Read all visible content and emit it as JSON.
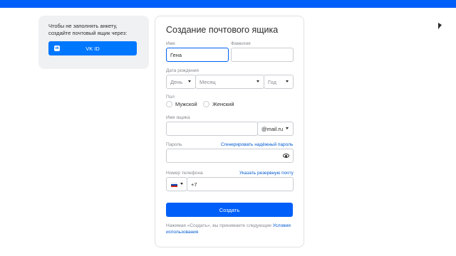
{
  "vk": {
    "hint": "Чтобы не заполнять анкету, создайте почтовый ящик через:",
    "button_label": "VK ID"
  },
  "form": {
    "title": "Создание почтового ящика",
    "first_name": {
      "label": "Имя",
      "value": "Гена"
    },
    "last_name": {
      "label": "Фамилия",
      "value": ""
    },
    "birth_date": {
      "label": "Дата рождения",
      "day": "День",
      "month": "Месяц",
      "year": "Год"
    },
    "gender": {
      "label": "Пол",
      "male": "Мужской",
      "female": "Женский"
    },
    "mailbox": {
      "label": "Имя ящика",
      "value": "",
      "domain": "@mail.ru"
    },
    "password": {
      "label": "Пароль",
      "generate_link": "Сгенерировать надёжный пароль",
      "value": ""
    },
    "phone": {
      "label": "Номер телефона",
      "backup_link": "Указать резервную почту",
      "prefix": "+7"
    },
    "submit_label": "Создать",
    "terms_text": "Нажимая «Создать», вы принимаете следующие ",
    "terms_link": "Условия использования"
  },
  "colors": {
    "accent": "#005ff9",
    "vk_blue": "#0077ff",
    "link": "#005bd1"
  }
}
